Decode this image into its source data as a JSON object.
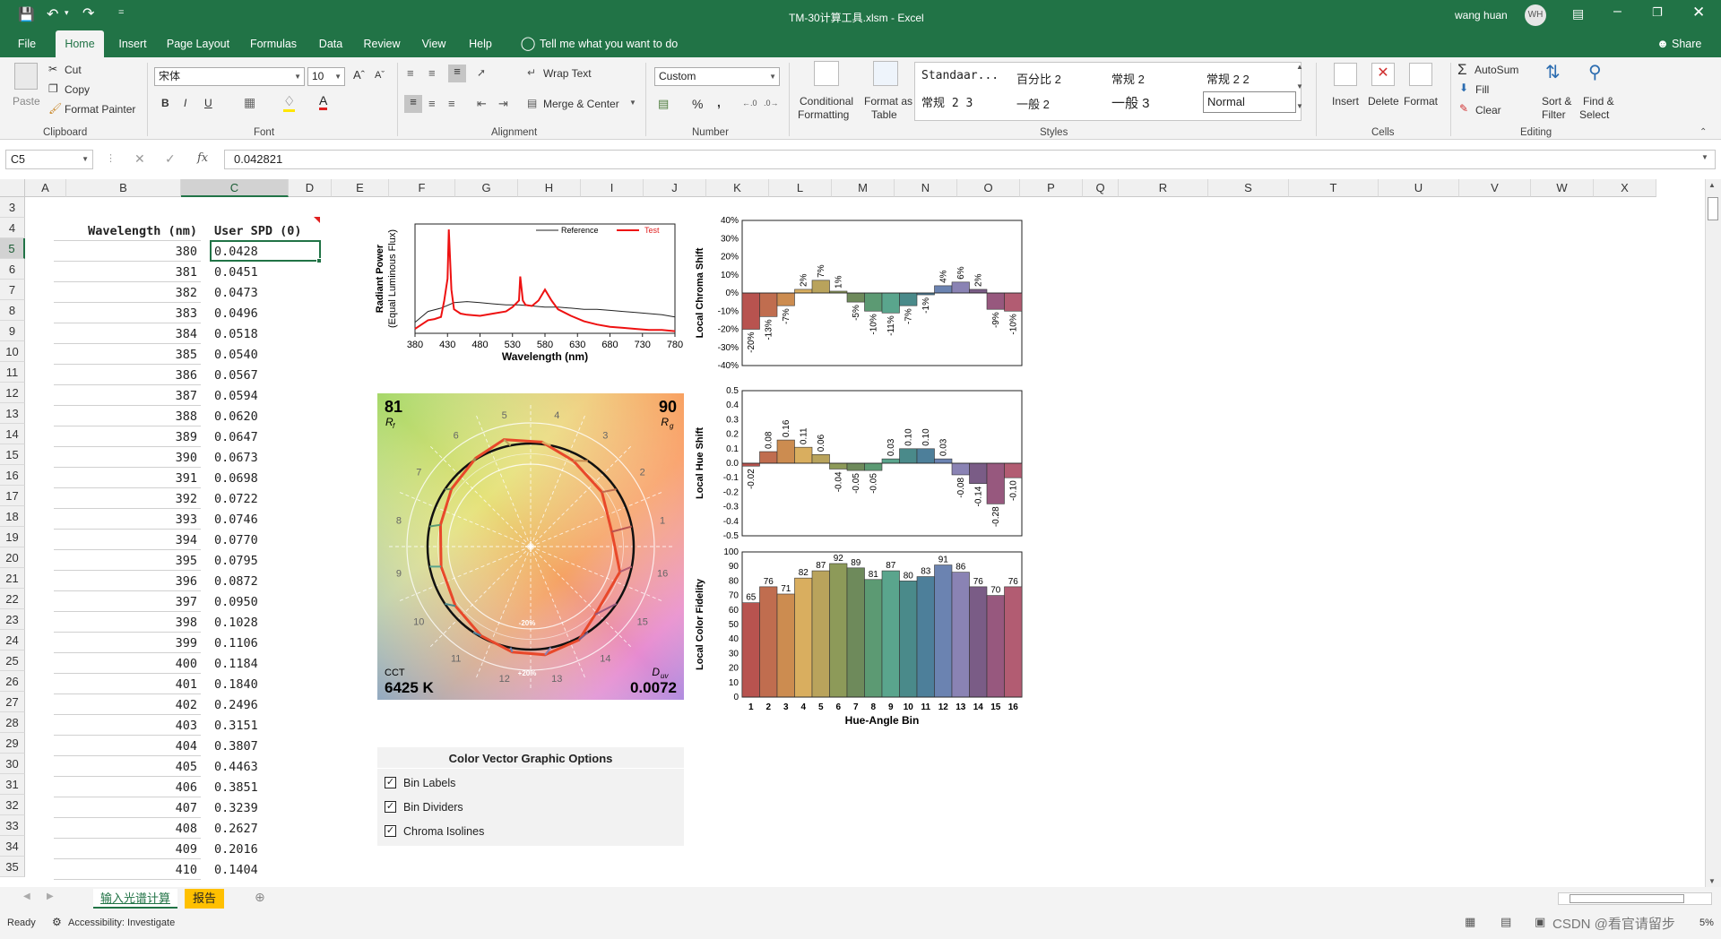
{
  "titlebar": {
    "title": "TM-30计算工具.xlsm  -  Excel",
    "user": "wang huan",
    "user_initials": "WH",
    "qat_more": "="
  },
  "ribbon_tabs": [
    "File",
    "Home",
    "Insert",
    "Page Layout",
    "Formulas",
    "Data",
    "Review",
    "View",
    "Help"
  ],
  "tell_me": "Tell me what you want to do",
  "share": "Share",
  "clipboard": {
    "paste": "Paste",
    "cut": "Cut",
    "copy": "Copy",
    "format_painter": "Format Painter",
    "label": "Clipboard"
  },
  "font": {
    "name": "宋体",
    "size": "10",
    "bold": "B",
    "italic": "I",
    "underline": "U",
    "label": "Font"
  },
  "alignment": {
    "wrap": "Wrap Text",
    "merge": "Merge & Center",
    "label": "Alignment"
  },
  "number": {
    "format": "Custom",
    "percent": "%",
    "comma": ",",
    "label": "Number"
  },
  "styles": {
    "conditional": "Conditional",
    "conditional2": "Formatting",
    "format_as": "Format as",
    "format_as2": "Table",
    "cells": [
      "Standaar...",
      "百分比 2",
      "常规 2",
      "常规 2 2",
      "常规 2 3",
      "一般 2",
      "一般 3",
      "Normal"
    ],
    "label": "Styles"
  },
  "cells_group": {
    "insert": "Insert",
    "delete": "Delete",
    "format": "Format",
    "label": "Cells"
  },
  "editing": {
    "autosum": "AutoSum",
    "fill": "Fill",
    "clear": "Clear",
    "sort": "Sort &",
    "sort2": "Filter",
    "find": "Find &",
    "find2": "Select",
    "label": "Editing"
  },
  "formula_bar": {
    "name_box": "C5",
    "fx": "fx",
    "value": "0.042821"
  },
  "columns": [
    "A",
    "B",
    "C",
    "D",
    "E",
    "F",
    "G",
    "H",
    "I",
    "J",
    "K",
    "L",
    "M",
    "N",
    "O",
    "P",
    "Q",
    "R",
    "S",
    "T",
    "U",
    "V",
    "W",
    "X"
  ],
  "rows": [
    "3",
    "4",
    "5",
    "6",
    "7",
    "8",
    "9",
    "10",
    "11",
    "12",
    "13",
    "14",
    "15",
    "16",
    "17",
    "18",
    "19",
    "20",
    "21",
    "22",
    "23",
    "24",
    "25",
    "26",
    "27",
    "28",
    "29",
    "30",
    "31",
    "32",
    "33",
    "34",
    "35"
  ],
  "table": {
    "header_b": "Wavelength (nm)",
    "header_c": "User SPD (0)",
    "wavelengths": [
      "380",
      "381",
      "382",
      "383",
      "384",
      "385",
      "386",
      "387",
      "388",
      "389",
      "390",
      "391",
      "392",
      "393",
      "394",
      "395",
      "396",
      "397",
      "398",
      "399",
      "400",
      "401",
      "402",
      "403",
      "404",
      "405",
      "406",
      "407",
      "408",
      "409",
      "410"
    ],
    "spd": [
      "0.0428",
      "0.0451",
      "0.0473",
      "0.0496",
      "0.0518",
      "0.0540",
      "0.0567",
      "0.0594",
      "0.0620",
      "0.0647",
      "0.0673",
      "0.0698",
      "0.0722",
      "0.0746",
      "0.0770",
      "0.0795",
      "0.0872",
      "0.0950",
      "0.1028",
      "0.1106",
      "0.1184",
      "0.1840",
      "0.2496",
      "0.3151",
      "0.3807",
      "0.4463",
      "0.3851",
      "0.3239",
      "0.2627",
      "0.2016",
      "0.1404"
    ]
  },
  "chart_data": [
    {
      "type": "line",
      "title": "",
      "xlabel": "Wavelength (nm)",
      "ylabel": "Radiant Power",
      "ylabel2": "(Equal Luminous Flux)",
      "xticks": [
        "380",
        "430",
        "480",
        "530",
        "580",
        "630",
        "680",
        "730",
        "780"
      ],
      "xlim": [
        380,
        780
      ],
      "ylim": [
        0,
        1
      ],
      "series": [
        {
          "name": "Reference",
          "color": "#222222",
          "x": [
            380,
            400,
            420,
            440,
            460,
            480,
            500,
            520,
            540,
            560,
            580,
            600,
            620,
            640,
            660,
            680,
            700,
            720,
            740,
            760,
            780
          ],
          "y": [
            0.1,
            0.2,
            0.23,
            0.28,
            0.29,
            0.28,
            0.27,
            0.26,
            0.26,
            0.25,
            0.24,
            0.24,
            0.23,
            0.22,
            0.22,
            0.21,
            0.2,
            0.19,
            0.18,
            0.17,
            0.15
          ]
        },
        {
          "name": "Test",
          "color": "#ee1111",
          "x": [
            380,
            400,
            410,
            420,
            425,
            430,
            432,
            436,
            440,
            450,
            460,
            480,
            500,
            520,
            530,
            540,
            542,
            546,
            550,
            560,
            570,
            580,
            590,
            600,
            620,
            640,
            660,
            680,
            700,
            720,
            740,
            760,
            780
          ],
          "y": [
            0.04,
            0.12,
            0.13,
            0.15,
            0.3,
            0.5,
            0.95,
            0.4,
            0.22,
            0.18,
            0.17,
            0.16,
            0.18,
            0.2,
            0.24,
            0.3,
            0.52,
            0.3,
            0.26,
            0.25,
            0.3,
            0.4,
            0.3,
            0.22,
            0.16,
            0.11,
            0.08,
            0.06,
            0.05,
            0.04,
            0.03,
            0.03,
            0.02
          ]
        }
      ]
    },
    {
      "type": "bar",
      "title": "",
      "ylabel": "Local Chroma Shift",
      "ylim": [
        -40,
        40
      ],
      "yticks": [
        "40%",
        "30%",
        "20%",
        "10%",
        "0%",
        "-10%",
        "-20%",
        "-30%",
        "-40%"
      ],
      "categories": [
        "1",
        "2",
        "3",
        "4",
        "5",
        "6",
        "7",
        "8",
        "9",
        "10",
        "11",
        "12",
        "13",
        "14",
        "15",
        "16"
      ],
      "values": [
        -20,
        -13,
        -7,
        2,
        7,
        1,
        -5,
        -10,
        -11,
        -7,
        -1,
        4,
        6,
        2,
        -9,
        -10
      ],
      "labels": [
        "-20%",
        "-13%",
        "-7%",
        "2%",
        "7%",
        "1%",
        "-5%",
        "-10%",
        "-11%",
        "-7%",
        "-1%",
        "4%",
        "6%",
        "2%",
        "-9%",
        "-10%"
      ]
    },
    {
      "type": "bar",
      "title": "",
      "ylabel": "Local Hue Shift",
      "ylim": [
        -0.5,
        0.5
      ],
      "yticks": [
        "0.5",
        "0.4",
        "0.3",
        "0.2",
        "0.1",
        "0.0",
        "-0.1",
        "-0.2",
        "-0.3",
        "-0.4",
        "-0.5"
      ],
      "categories": [
        "1",
        "2",
        "3",
        "4",
        "5",
        "6",
        "7",
        "8",
        "9",
        "10",
        "11",
        "12",
        "13",
        "14",
        "15",
        "16"
      ],
      "values": [
        -0.02,
        0.08,
        0.16,
        0.11,
        0.06,
        -0.04,
        -0.05,
        -0.05,
        0.03,
        0.1,
        0.1,
        0.03,
        -0.08,
        -0.14,
        -0.28,
        -0.1
      ],
      "labels": [
        "-0.02",
        "0.08",
        "0.16",
        "0.11",
        "0.06",
        "-0.04",
        "-0.05",
        "-0.05",
        "0.03",
        "0.10",
        "0.10",
        "0.03",
        "-0.08",
        "-0.14",
        "-0.28",
        "-0.10"
      ]
    },
    {
      "type": "bar",
      "title": "",
      "xlabel": "Hue-Angle Bin",
      "ylabel": "Local Color Fidelity",
      "ylim": [
        0,
        100
      ],
      "yticks": [
        "100",
        "90",
        "80",
        "70",
        "60",
        "50",
        "40",
        "30",
        "20",
        "10",
        "0"
      ],
      "categories": [
        "1",
        "2",
        "3",
        "4",
        "5",
        "6",
        "7",
        "8",
        "9",
        "10",
        "11",
        "12",
        "13",
        "14",
        "15",
        "16"
      ],
      "values": [
        65,
        76,
        71,
        82,
        87,
        92,
        89,
        81,
        87,
        80,
        83,
        91,
        86,
        76,
        70,
        76
      ]
    }
  ],
  "bin_colors": [
    "#b8534f",
    "#c06d4f",
    "#cc8c50",
    "#d9ae5f",
    "#b9a35c",
    "#8d9a59",
    "#6e8a5b",
    "#5c9a73",
    "#5aa58d",
    "#4a8a8a",
    "#4d7f9a",
    "#6b83b1",
    "#8a83b4",
    "#7a5c86",
    "#97587e",
    "#b25c72"
  ],
  "cvg": {
    "rf": "81",
    "rf_label": "R",
    "rf_sub": "f",
    "rg": "90",
    "rg_label": "R",
    "rg_sub": "g",
    "cct_label": "CCT",
    "cct": "6425 K",
    "duv_label": "D",
    "duv_sub": "uv",
    "duv": "0.0072",
    "bins": [
      "1",
      "2",
      "3",
      "4",
      "5",
      "6",
      "7",
      "8",
      "9",
      "10",
      "11",
      "12",
      "13",
      "14",
      "15",
      "16"
    ],
    "iso_minus": "-20%",
    "iso_plus": "+20%"
  },
  "options": {
    "title": "Color Vector Graphic Options",
    "items": [
      "Bin Labels",
      "Bin Dividers",
      "Chroma Isolines"
    ],
    "checked": [
      true,
      true,
      true
    ]
  },
  "sheets": [
    "输入光谱计算",
    "报告"
  ],
  "status": {
    "ready": "Ready",
    "accessibility": "Accessibility: Investigate",
    "watermark": "CSDN @看官请留步",
    "zoom": "5%"
  }
}
